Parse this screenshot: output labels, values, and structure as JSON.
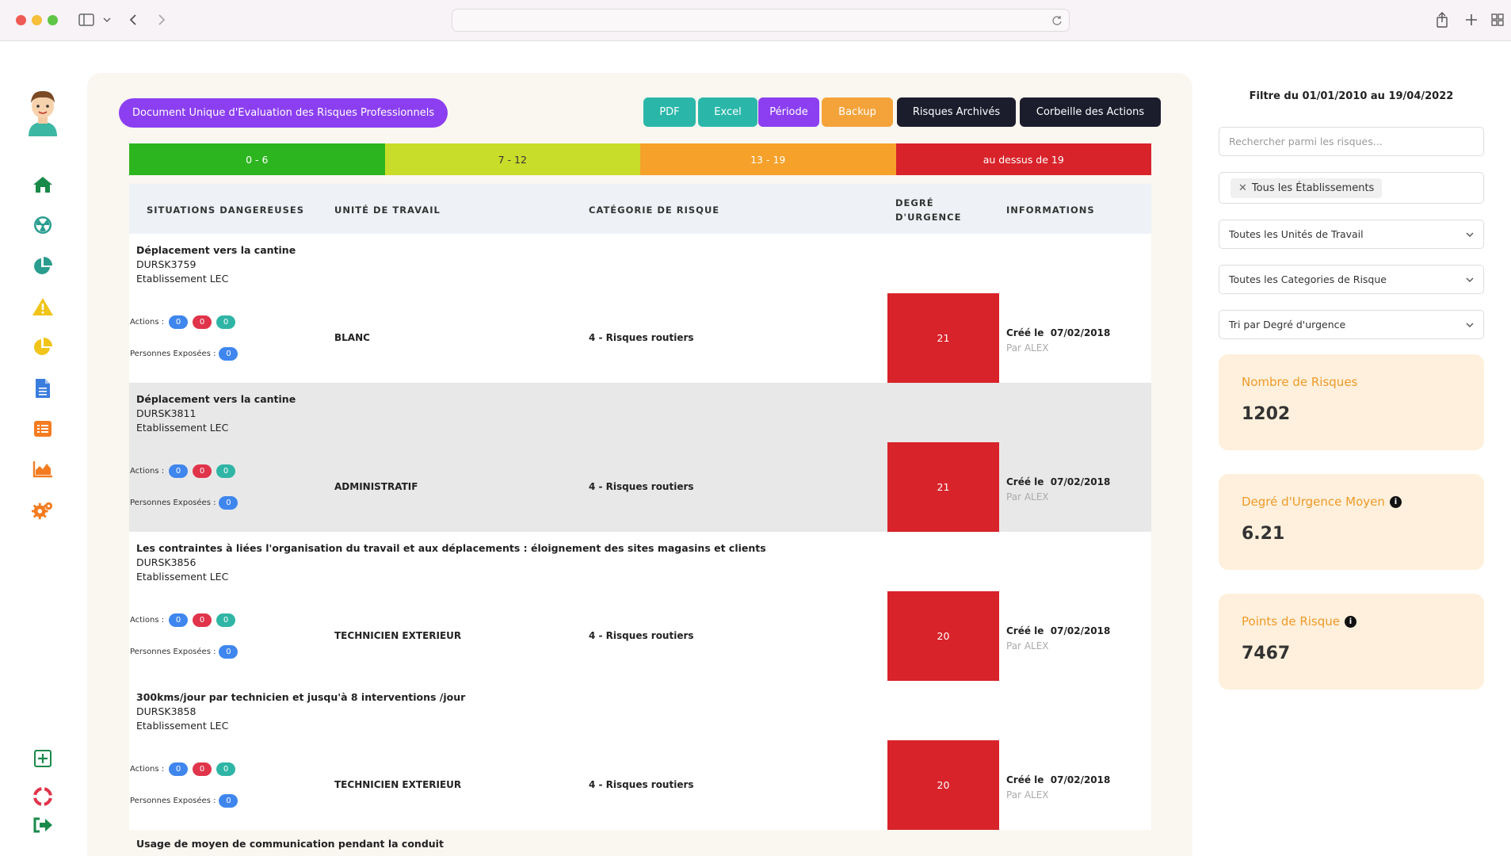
{
  "app": {
    "title": "Document Unique d'Evaluation des Risques Professionnels"
  },
  "toolbar": {
    "buttons": [
      {
        "label": "PDF",
        "color": "#2ab7a9"
      },
      {
        "label": "Excel",
        "color": "#2ab7a9"
      },
      {
        "label": "Période",
        "color": "#8b3ff0"
      },
      {
        "label": "Backup",
        "color": "#f4a33a"
      },
      {
        "label": "Risques Archivés",
        "color": "#1b1d2c"
      },
      {
        "label": "Corbeille des Actions",
        "color": "#1b1d2c"
      }
    ]
  },
  "legend": [
    {
      "label": "0 - 6",
      "color": "#2db51f"
    },
    {
      "label": "7 - 12",
      "color": "#c8dc2a"
    },
    {
      "label": "13 - 19",
      "color": "#f5a12a"
    },
    {
      "label": "au dessus de 19",
      "color": "#d8232a"
    }
  ],
  "table": {
    "headers": {
      "situations": "SITUATIONS DANGEREUSES",
      "unit": "UNITÉ DE TRAVAIL",
      "category": "CATÉGORIE DE RISQUE",
      "degree_line1": "DEGRÉ",
      "degree_line2": "D'URGENCE",
      "info": "INFORMATIONS"
    },
    "actions_label": "Actions :",
    "exposed_label": "Personnes Exposées :",
    "created_label": "Créé le",
    "by_prefix": "Par",
    "rows": [
      {
        "title": "Déplacement vers la cantine",
        "code": "DURSK3759",
        "etablissement": "Etablissement LEC",
        "actions": [
          "0",
          "0",
          "0"
        ],
        "exposed": "0",
        "unit": "BLANC",
        "category": "4 - Risques routiers",
        "degree": "21",
        "created": "07/02/2018",
        "by": "ALEX"
      },
      {
        "title": "Déplacement vers la cantine",
        "code": "DURSK3811",
        "etablissement": "Etablissement LEC",
        "actions": [
          "0",
          "0",
          "0"
        ],
        "exposed": "0",
        "unit": "ADMINISTRATIF",
        "category": "4 - Risques routiers",
        "degree": "21",
        "created": "07/02/2018",
        "by": "ALEX"
      },
      {
        "title": "Les contraintes à liées l'organisation du travail et aux déplacements : éloignement des sites magasins et clients",
        "code": "DURSK3856",
        "etablissement": "Etablissement LEC",
        "actions": [
          "0",
          "0",
          "0"
        ],
        "exposed": "0",
        "unit": "TECHNICIEN EXTERIEUR",
        "category": "4 - Risques routiers",
        "degree": "20",
        "created": "07/02/2018",
        "by": "ALEX"
      },
      {
        "title": "300kms/jour par technicien et jusqu'à 8 interventions /jour",
        "code": "DURSK3858",
        "etablissement": "Etablissement LEC",
        "actions": [
          "0",
          "0",
          "0"
        ],
        "exposed": "0",
        "unit": "TECHNICIEN EXTERIEUR",
        "category": "4 - Risques routiers",
        "degree": "20",
        "created": "07/02/2018",
        "by": "ALEX"
      }
    ],
    "partial_row_title": "Usage de moyen de communication pendant la conduit"
  },
  "sidebar": {
    "icons": [
      {
        "name": "home-icon",
        "color": "#1a8a4a"
      },
      {
        "name": "radiation-icon",
        "color": "#2a9d8f"
      },
      {
        "name": "pie-chart-icon",
        "color": "#2a9d8f"
      },
      {
        "name": "warning-icon",
        "color": "#f0c419"
      },
      {
        "name": "pie-chart-yellow-icon",
        "color": "#f0c419"
      },
      {
        "name": "document-icon",
        "color": "#3b7ddd"
      },
      {
        "name": "list-icon",
        "color": "#f47c20"
      },
      {
        "name": "area-chart-icon",
        "color": "#f47c20"
      },
      {
        "name": "cogs-icon",
        "color": "#f47c20"
      },
      {
        "name": "add-square-icon",
        "color": "#1a8a4a"
      },
      {
        "name": "lifebuoy-icon",
        "color": "#e0344a"
      },
      {
        "name": "logout-icon",
        "color": "#1a8a4a"
      }
    ]
  },
  "panel": {
    "filter_title": "Filtre du 01/01/2010 au 19/04/2022",
    "search_placeholder": "Rechercher parmi les risques...",
    "etablissement_tag": "Tous les Établissements",
    "unit_select": "Toutes les Unités de Travail",
    "category_select": "Toutes les Categories de Risque",
    "sort_select": "Tri par Degré d'urgence",
    "stats": [
      {
        "label": "Nombre de Risques",
        "value": "1202",
        "info": false
      },
      {
        "label": "Degré d'Urgence Moyen",
        "value": "6.21",
        "info": true
      },
      {
        "label": "Points de Risque",
        "value": "7467",
        "info": true
      }
    ]
  }
}
